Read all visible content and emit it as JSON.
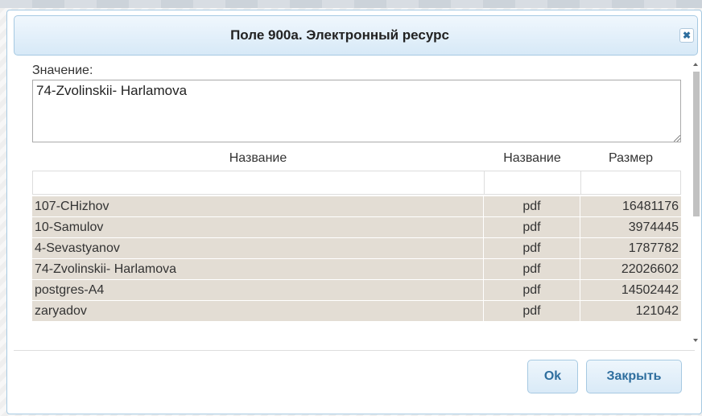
{
  "dialog": {
    "title": "Поле 900а. Электронный ресурс",
    "close_glyph": "✖"
  },
  "value": {
    "label": "Значение:",
    "text": "74-Zvolinskii- Harlamova"
  },
  "table": {
    "headers": [
      "Название",
      "Название",
      "Размер"
    ],
    "rows": [
      {
        "name": "107-CHizhov",
        "type": "pdf",
        "size": "16481176"
      },
      {
        "name": "10-Samulov",
        "type": "pdf",
        "size": "3974445"
      },
      {
        "name": "4-Sevastyanov",
        "type": "pdf",
        "size": "1787782"
      },
      {
        "name": "74-Zvolinskii- Harlamova",
        "type": "pdf",
        "size": "22026602"
      },
      {
        "name": "postgres-A4",
        "type": "pdf",
        "size": "14502442"
      },
      {
        "name": "zaryadov",
        "type": "pdf",
        "size": "121042"
      }
    ]
  },
  "buttons": {
    "ok": "Ok",
    "close": "Закрыть"
  },
  "colors": {
    "accent": "#2e6e9e",
    "row_bg": "#e3ddd4",
    "border": "#a6c9e2"
  }
}
